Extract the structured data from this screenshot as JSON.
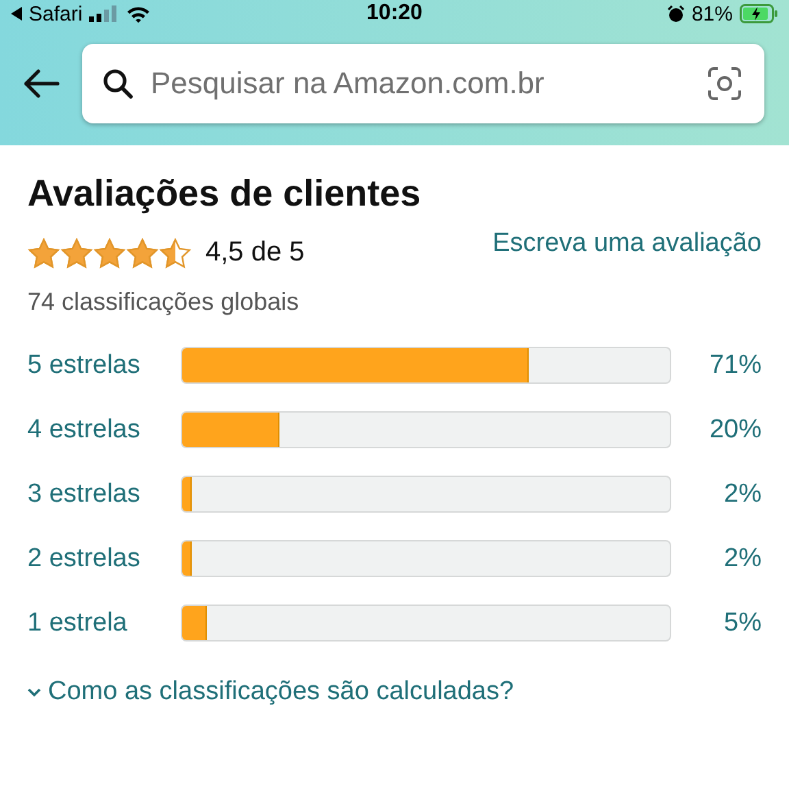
{
  "status_bar": {
    "back_app": "Safari",
    "time": "10:20",
    "battery": "81%"
  },
  "search": {
    "placeholder": "Pesquisar na Amazon.com.br"
  },
  "reviews": {
    "title": "Avaliações de clientes",
    "stars": 4.5,
    "rating": "4,5 de 5",
    "write_review": "Escreva uma avaliação",
    "total": "74 classificações globais",
    "histogram": [
      {
        "label": "5 estrelas",
        "level": 0.71,
        "percent": "71%"
      },
      {
        "label": "4 estrelas",
        "level": 0.2,
        "percent": "20%"
      },
      {
        "label": "3 estrelas",
        "level": 0.02,
        "percent": "2%"
      },
      {
        "label": "2 estrelas",
        "level": 0.02,
        "percent": "2%"
      },
      {
        "label": "1 estrela",
        "level": 0.05,
        "percent": "5%"
      }
    ],
    "how_calculated": "Como as classificações são calculadas?"
  }
}
